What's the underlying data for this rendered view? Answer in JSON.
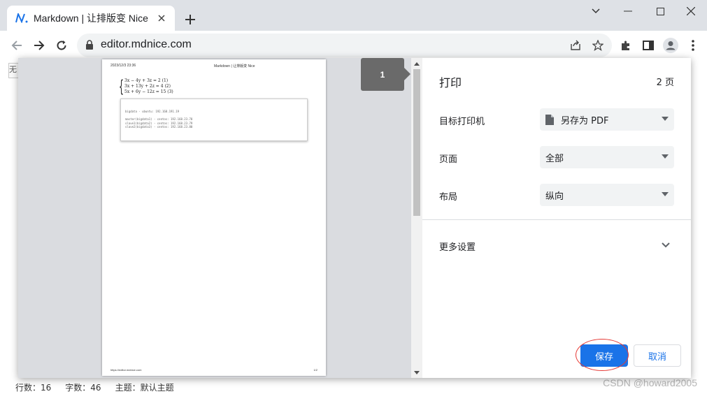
{
  "browser": {
    "tab_title": "Markdown | 让排版变 Nice",
    "url": "editor.mdnice.com"
  },
  "print_dialog": {
    "title": "打印",
    "page_count": "2 页",
    "page_badge": "1",
    "rows": [
      {
        "label": "目标打印机",
        "value": "另存为 PDF"
      },
      {
        "label": "页面",
        "value": "全部"
      },
      {
        "label": "布局",
        "value": "纵向"
      }
    ],
    "more_settings": "更多设置",
    "save_label": "保存",
    "cancel_label": "取消"
  },
  "preview_page": {
    "header_left": "2023/12/3 23:36",
    "header_center": "Markdown | 让排版变 Nice",
    "math_lines": [
      "3x − 4y + 3z = 2      (1)",
      "3x + 13y + 2z = 4    (2)",
      "5x + 6y − 12z = 15   (3)"
    ],
    "code_lines": [
      "bigdata - ubuntu: 192.168.191.19",
      "",
      "master(bigdata1) - centos: 192.168.23.78",
      "slave1(bigdata2) - centos: 192.168.23.79",
      "slave2(bigdata3) - centos: 192.168.23.80"
    ],
    "footer_left": "https://editor.mdnice.com",
    "footer_right": "1/2"
  },
  "underlying_page": {
    "status_lines": "行数：16",
    "status_chars": "字数：46",
    "status_theme": "主题：默认主题",
    "editor_button_char": "无"
  },
  "watermark": "CSDN @howard2005",
  "colors": {
    "accent": "#1a73e8",
    "annotation": "#e53935"
  }
}
